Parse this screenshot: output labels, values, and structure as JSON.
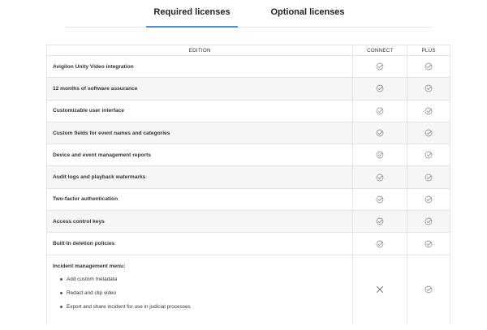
{
  "tabs": [
    {
      "label": "Required licenses",
      "active": true
    },
    {
      "label": "Optional licenses",
      "active": false
    }
  ],
  "accent_color": "#4a90d9",
  "table": {
    "headers": {
      "edition": "EDITION",
      "connect": "CONNECT",
      "plus": "PLUS"
    },
    "rows": [
      {
        "feature": "Avigilon Unity Video integration",
        "connect": "check-icon",
        "plus": "check-icon"
      },
      {
        "feature": "12 months of software assurance",
        "connect": "check-icon",
        "plus": "check-icon"
      },
      {
        "feature": "Customizable user interface",
        "connect": "check-icon",
        "plus": "check-icon"
      },
      {
        "feature": "Custom fields for event names and categories",
        "connect": "check-icon",
        "plus": "check-icon"
      },
      {
        "feature": "Device and event management reports",
        "connect": "check-icon",
        "plus": "check-icon"
      },
      {
        "feature": "Audit logs and playback watermarks",
        "connect": "check-icon",
        "plus": "check-icon"
      },
      {
        "feature": "Two-factor authentication",
        "connect": "check-icon",
        "plus": "check-icon"
      },
      {
        "feature": "Access control keys",
        "connect": "check-icon",
        "plus": "check-icon"
      },
      {
        "feature": "Built-In deletion policies",
        "connect": "check-icon",
        "plus": "check-icon"
      }
    ],
    "incident": {
      "title": "Incident management menu:",
      "items": [
        "Add custom metadata",
        "Redact and clip video",
        "Export and share incident for use in judicial processes"
      ],
      "connect": "x-icon",
      "plus": "check-icon"
    }
  }
}
